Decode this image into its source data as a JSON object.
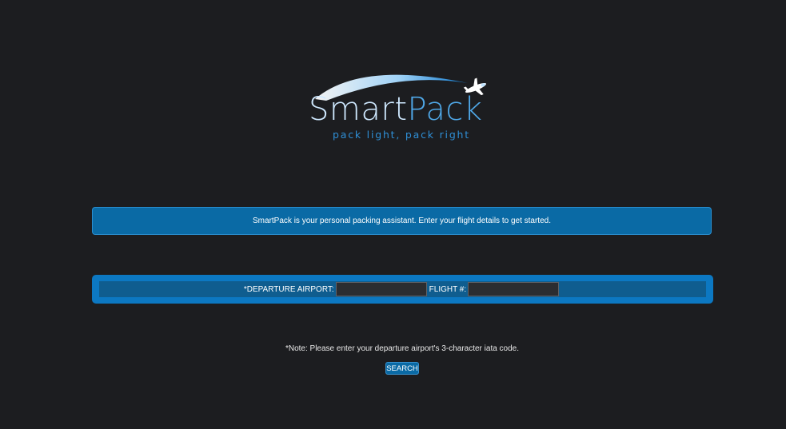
{
  "logo": {
    "title_part1": "Smart",
    "title_part2": "Pack",
    "tagline": "pack light, pack right"
  },
  "banner": {
    "text": "SmartPack is your personal packing assistant. Enter your flight details to get started."
  },
  "form": {
    "departure_label": "*DEPARTURE AIRPORT:",
    "departure_value": "",
    "flight_label": "FLIGHT #:",
    "flight_value": ""
  },
  "note": {
    "text": "*Note: Please enter your departure airport's 3-character iata code."
  },
  "search_button": {
    "label": "SEARCH"
  },
  "colors": {
    "background": "#1c1d20",
    "accent": "#0a6aa5",
    "panel": "#0c78c2"
  },
  "icons": {
    "logo_graphic": "airplane-arc-icon"
  }
}
